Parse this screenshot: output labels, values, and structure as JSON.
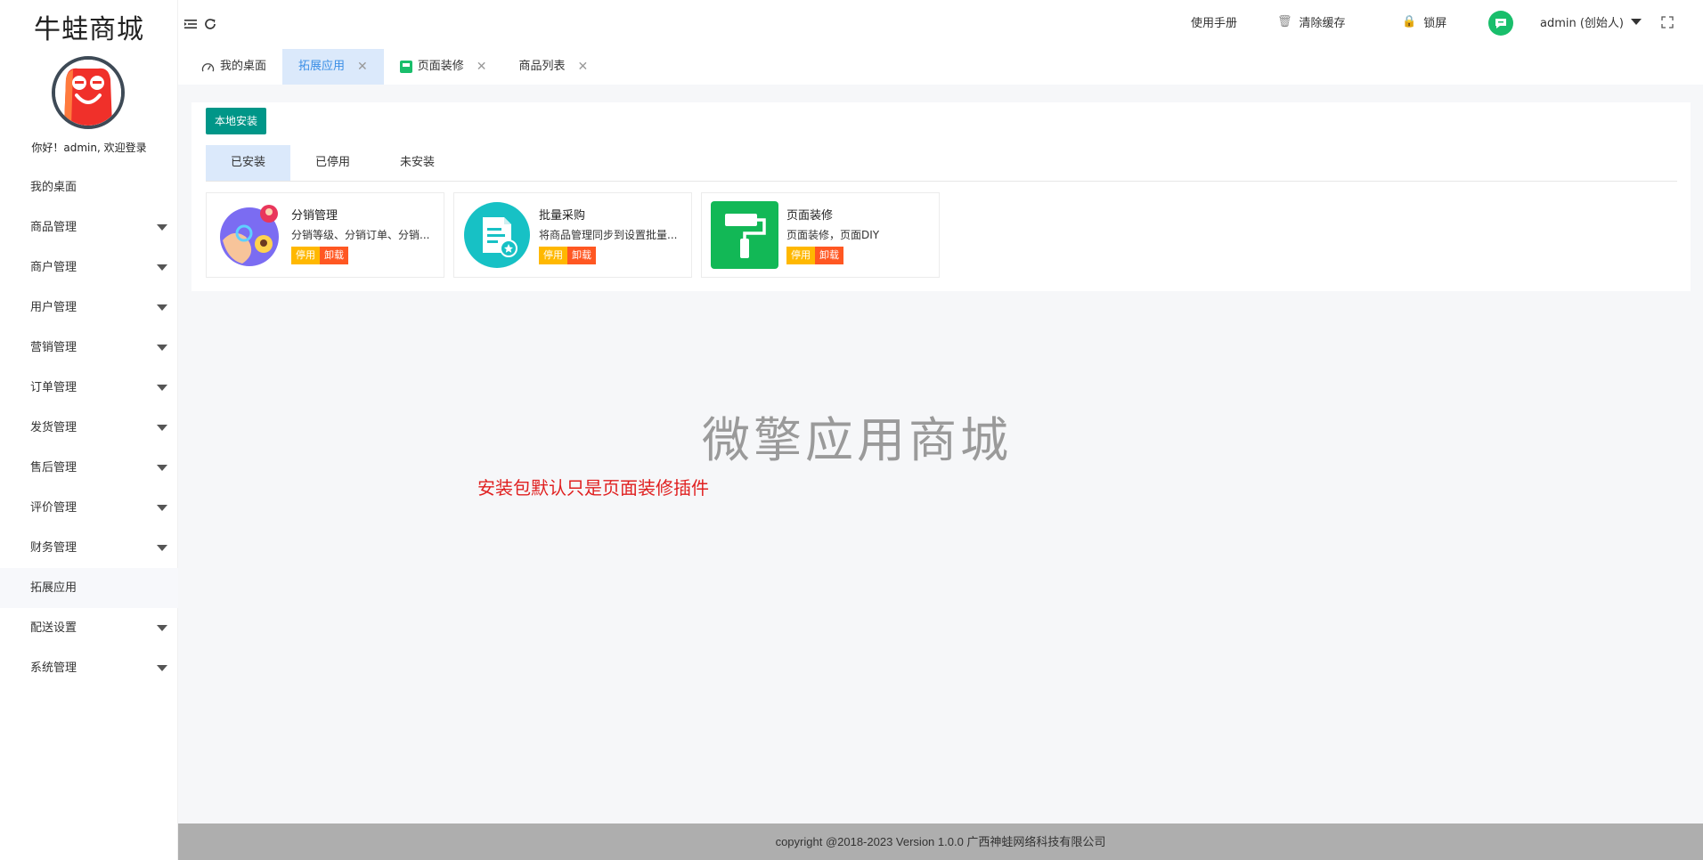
{
  "sidebar": {
    "logo": "牛蛙商城",
    "greeting": "你好！admin, 欢迎登录",
    "items": [
      {
        "label": "我的桌面",
        "expandable": false
      },
      {
        "label": "商品管理",
        "expandable": true
      },
      {
        "label": "商户管理",
        "expandable": true
      },
      {
        "label": "用户管理",
        "expandable": true
      },
      {
        "label": "营销管理",
        "expandable": true
      },
      {
        "label": "订单管理",
        "expandable": true
      },
      {
        "label": "发货管理",
        "expandable": true
      },
      {
        "label": "售后管理",
        "expandable": true
      },
      {
        "label": "评价管理",
        "expandable": true
      },
      {
        "label": "财务管理",
        "expandable": true
      },
      {
        "label": "拓展应用",
        "expandable": false,
        "active": true
      },
      {
        "label": "配送设置",
        "expandable": true
      },
      {
        "label": "系统管理",
        "expandable": true
      }
    ]
  },
  "header": {
    "manual": "使用手册",
    "clear_cache": "清除缓存",
    "lock": "锁屏",
    "user": "admin (创始人)"
  },
  "tabs": [
    {
      "label": "我的桌面",
      "icon": "dashboard-icon",
      "closable": false
    },
    {
      "label": "拓展应用",
      "active": true,
      "closable": true
    },
    {
      "label": "页面装修",
      "icon": "decorate-icon",
      "closable": true
    },
    {
      "label": "商品列表",
      "closable": true
    }
  ],
  "content": {
    "local_install": "本地安装",
    "sub_tabs": [
      "已安装",
      "已停用",
      "未安装"
    ],
    "plugins": [
      {
        "name": "分销管理",
        "desc": "分销等级、分销订单、分销...",
        "disable": "停用",
        "uninstall": "卸载",
        "icon": "distribution-icon"
      },
      {
        "name": "批量采购",
        "desc": "将商品管理同步到设置批量...",
        "disable": "停用",
        "uninstall": "卸载",
        "icon": "purchase-icon"
      },
      {
        "name": "页面装修",
        "desc": "页面装修，页面DIY",
        "disable": "停用",
        "uninstall": "卸载",
        "icon": "paint-roller-icon"
      }
    ],
    "watermark": "微擎应用商城",
    "note": "安装包默认只是页面装修插件"
  },
  "footer": "copyright @2018-2023 Version 1.0.0 广西神蛙网络科技有限公司",
  "colors": {
    "primary": "#009688",
    "warn": "#ffb800",
    "danger": "#ff5722",
    "tab_active_bg": "#dbe9fb",
    "note": "#e02020"
  }
}
